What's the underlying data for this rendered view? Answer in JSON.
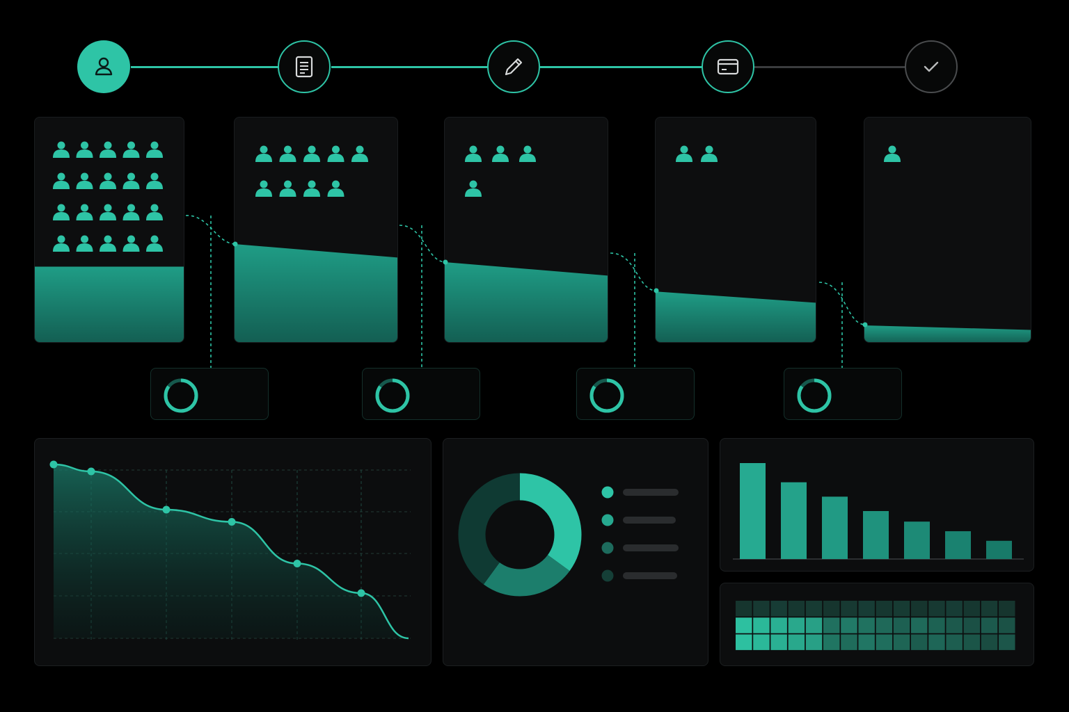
{
  "colors": {
    "accent": "#2ec4a6",
    "accent_dim": "#1c8a76",
    "background": "#000000",
    "panel": "#0c0d0e",
    "inactive": "#4a4c4e"
  },
  "stepper": {
    "steps": [
      {
        "icon": "user-icon",
        "state": "current"
      },
      {
        "icon": "document-icon",
        "state": "complete"
      },
      {
        "icon": "pencil-icon",
        "state": "complete"
      },
      {
        "icon": "credit-card-icon",
        "state": "complete"
      },
      {
        "icon": "check-icon",
        "state": "pending"
      }
    ]
  },
  "funnel": {
    "stages": [
      {
        "people_icons": 20,
        "level_start": 0.34,
        "level_end": 0.34
      },
      {
        "people_icons": 9,
        "level_start": 0.44,
        "level_end": 0.38
      },
      {
        "people_icons": 4,
        "level_start": 0.36,
        "level_end": 0.3
      },
      {
        "people_icons": 2,
        "level_start": 0.23,
        "level_end": 0.18
      },
      {
        "people_icons": 1,
        "level_start": 0.08,
        "level_end": 0.06
      }
    ],
    "conversion_rings": [
      {
        "progress": 0.85
      },
      {
        "progress": 0.85
      },
      {
        "progress": 0.85
      },
      {
        "progress": 0.85
      }
    ]
  },
  "chart_data": [
    {
      "type": "area",
      "x": [
        1,
        2,
        3,
        4,
        5,
        6,
        7
      ],
      "y": [
        100,
        96,
        74,
        67,
        43,
        26,
        0
      ],
      "markers": [
        true,
        true,
        true,
        true,
        true,
        true,
        false
      ],
      "ylim": [
        0,
        100
      ],
      "grid": true
    },
    {
      "type": "pie",
      "donut": true,
      "values": [
        35,
        25,
        40
      ],
      "colors": [
        "#2ec4a6",
        "#1c7e6c",
        "#0f3a33"
      ],
      "legend": [
        {
          "color": "#2ec4a6"
        },
        {
          "color": "#26a88f"
        },
        {
          "color": "#1d6b5d"
        },
        {
          "color": "#153f37"
        }
      ]
    },
    {
      "type": "bar",
      "values": [
        100,
        80,
        65,
        50,
        39,
        29,
        19
      ],
      "ylim": [
        0,
        100
      ]
    },
    {
      "type": "heatmap",
      "rows": 3,
      "cols": 16,
      "intensity_note": ""
    }
  ]
}
